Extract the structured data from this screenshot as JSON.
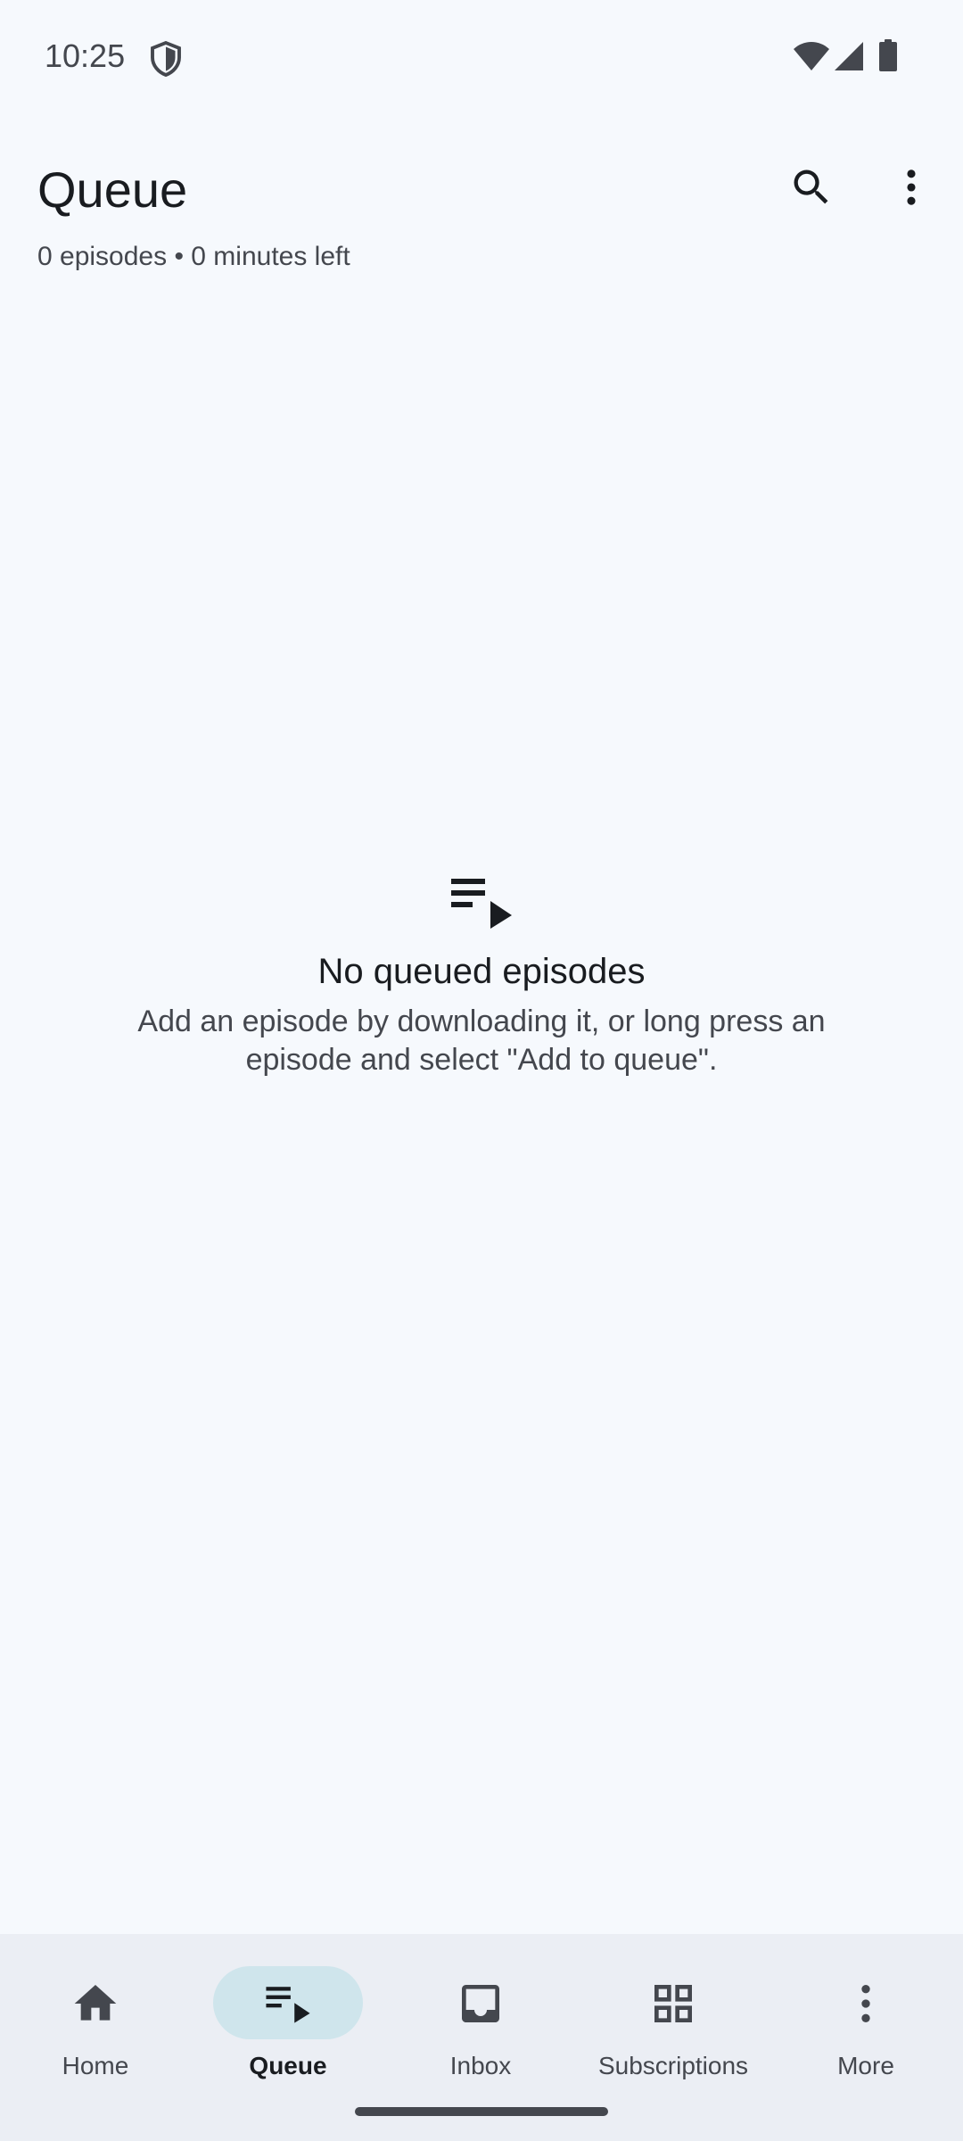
{
  "status_bar": {
    "time": "10:25",
    "icons": [
      "shield-icon",
      "wifi-icon",
      "signal-icon",
      "battery-icon"
    ]
  },
  "app_bar": {
    "title": "Queue",
    "subtitle": "0 episodes • 0 minutes left",
    "actions": [
      "search-icon",
      "more-vert-icon"
    ]
  },
  "empty_state": {
    "icon": "queue-playlist-icon",
    "title": "No queued episodes",
    "description": "Add an episode by downloading it, or long press an episode and select \"Add to queue\"."
  },
  "bottom_nav": {
    "items": [
      {
        "label": "Home",
        "icon": "home-icon",
        "active": false
      },
      {
        "label": "Queue",
        "icon": "queue-icon",
        "active": true
      },
      {
        "label": "Inbox",
        "icon": "inbox-icon",
        "active": false
      },
      {
        "label": "Subscriptions",
        "icon": "grid-icon",
        "active": false
      },
      {
        "label": "More",
        "icon": "more-vert-icon",
        "active": false
      }
    ]
  },
  "colors": {
    "background": "#f6f9fd",
    "nav_background": "#ebeef4",
    "active_pill": "#cfe5ec",
    "text_primary": "#191c20",
    "text_secondary": "#44474e"
  }
}
